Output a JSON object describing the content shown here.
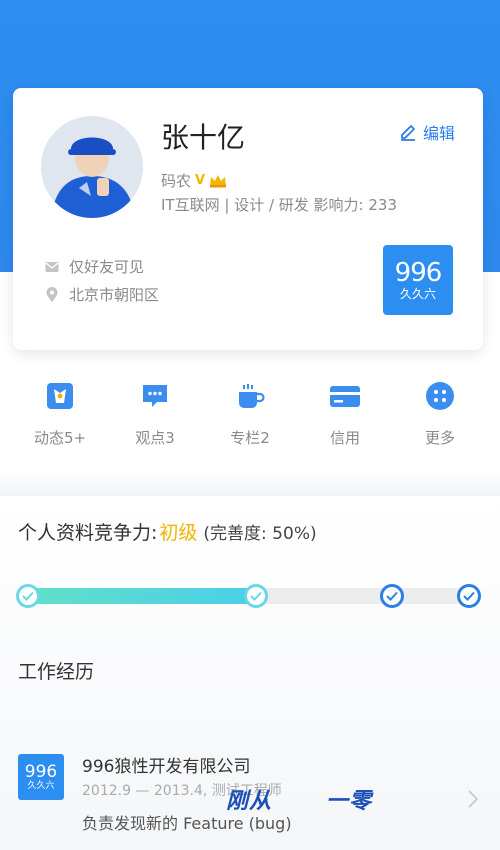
{
  "profile": {
    "name": "张十亿",
    "edit_label": "编辑",
    "role": "码农",
    "role_badge": "V",
    "industry_line": "IT互联网 | 设计 / 研发 影响力: 233",
    "visibility": "仅好友可见",
    "location": "北京市朝阳区",
    "company_logo_big": "996",
    "company_logo_small": "久久六"
  },
  "menu": {
    "items": [
      {
        "label": "动态5+",
        "icon": "activity-icon"
      },
      {
        "label": "观点3",
        "icon": "comment-icon"
      },
      {
        "label": "专栏2",
        "icon": "coffee-cup-icon"
      },
      {
        "label": "信用",
        "icon": "credit-card-icon"
      },
      {
        "label": "更多",
        "icon": "more-icon"
      }
    ]
  },
  "competitiveness": {
    "prefix": "个人资料竞争力:",
    "level": "初级",
    "completeness": "(完善度: 50%)",
    "progress": 0.5
  },
  "work": {
    "title": "工作经历",
    "jobs": [
      {
        "logo_big": "996",
        "logo_small": "久久六",
        "company": "996狼性开发有限公司",
        "dates": "2012.9 — 2013.4, 测试工程师",
        "description": "负责发现新的 Feature (bug)"
      }
    ]
  },
  "overlay": {
    "text1": "刚从",
    "text2": "一零"
  },
  "colors": {
    "brand_blue": "#2c8ef0",
    "accent_gold": "#f2b500",
    "progress_start": "#5fe0c8",
    "progress_end": "#4ccfe8"
  }
}
